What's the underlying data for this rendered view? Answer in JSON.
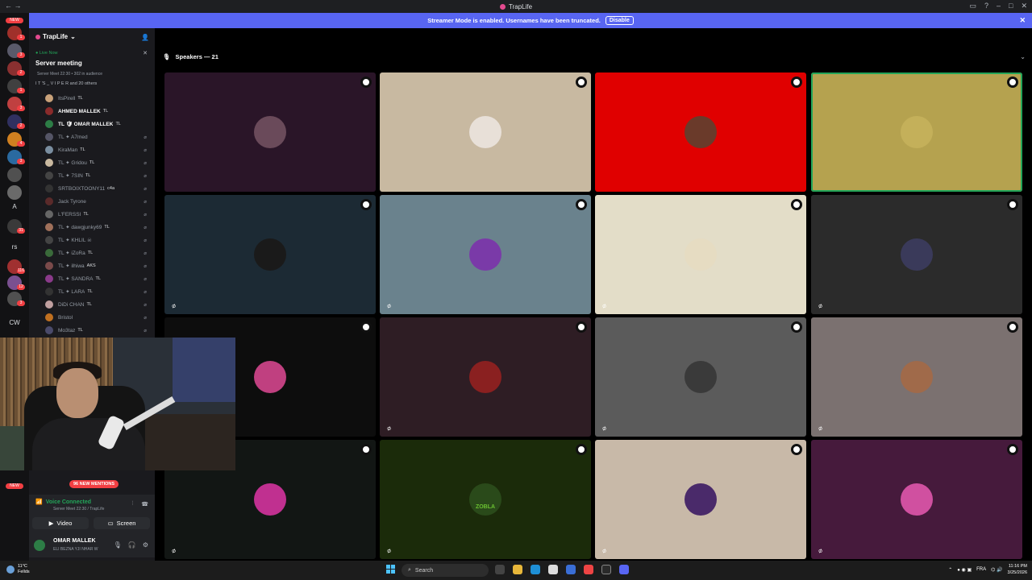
{
  "window": {
    "title": "TrapLife"
  },
  "banner": {
    "text": "Streamer Mode is enabled. Usernames have been truncated.",
    "button": "Disable"
  },
  "rail": {
    "new_label": "NEW",
    "new_label_bottom": "NEW",
    "letters": [
      "A",
      "rs",
      "CW"
    ],
    "badges": [
      "1",
      "3",
      "2",
      "1",
      "3",
      "2",
      "4",
      "3",
      "31",
      "116",
      "12",
      "3",
      "12"
    ]
  },
  "sidebar": {
    "server_name": "TrapLife",
    "live_label": "Live Now",
    "stage_title": "Server meeting",
    "stage_meta": "Server Meet 22:30  •  302 in audience",
    "audience_line": "I T 'S _ V I P E R and 20 others",
    "users": [
      {
        "name": "ItsPirell",
        "tag": "TL",
        "bright": false,
        "color": "#c9a27a",
        "mic": ""
      },
      {
        "name": "AHMED MALLEK",
        "tag": "TL",
        "bright": true,
        "color": "#8a2b2b",
        "mic": ""
      },
      {
        "name": "TL 🛡 OMAR MALLEK",
        "tag": "TL",
        "bright": true,
        "color": "#2d7d46",
        "mic": ""
      },
      {
        "name": "TL ✦ A7med",
        "tag": "",
        "bright": false,
        "color": "#556",
        "mic": "⌀"
      },
      {
        "name": "KiraMan",
        "tag": "TL",
        "bright": false,
        "color": "#7a8ea0",
        "mic": "⌀"
      },
      {
        "name": "TL ✦ Gridou",
        "tag": "TL",
        "bright": false,
        "color": "#c9b9a0",
        "mic": "⌀"
      },
      {
        "name": "TL ✦ 7SIN",
        "tag": "TL",
        "bright": false,
        "color": "#444",
        "mic": "⌀"
      },
      {
        "name": "SRTBOIXTOONY11",
        "tag": "c4a",
        "bright": false,
        "color": "#333",
        "mic": "⌀"
      },
      {
        "name": "Jack Tyrone",
        "tag": "",
        "bright": false,
        "color": "#5a2a2a",
        "mic": "⌀"
      },
      {
        "name": "L'FERSSI",
        "tag": "TL",
        "bright": false,
        "color": "#666",
        "mic": "⌀"
      },
      {
        "name": "TL ✦ dawgjunky69",
        "tag": "TL",
        "bright": false,
        "color": "#a0705a",
        "mic": "⌀"
      },
      {
        "name": "TL ✦ KHLIL ☠",
        "tag": "",
        "bright": false,
        "color": "#444",
        "mic": "⌀"
      },
      {
        "name": "TL ✦ iZoRa",
        "tag": "TL",
        "bright": false,
        "color": "#3a6a3a",
        "mic": "⌀"
      },
      {
        "name": "TL ✦ ilhiwa",
        "tag": "AKS",
        "bright": false,
        "color": "#7a4a4a",
        "mic": "⌀"
      },
      {
        "name": "TL ✦ SANDRA",
        "tag": "TL",
        "bright": false,
        "color": "#8a3a8a",
        "mic": "⌀"
      },
      {
        "name": "TL ✦ LARA",
        "tag": "TL",
        "bright": false,
        "color": "#333",
        "mic": "⌀"
      },
      {
        "name": "DiDi CHAN",
        "tag": "TL",
        "bright": false,
        "color": "#c0a0a0",
        "mic": "⌀"
      },
      {
        "name": "Bristol",
        "tag": "",
        "bright": false,
        "color": "#c07020",
        "mic": "⌀"
      },
      {
        "name": "Mo3taz",
        "tag": "TL",
        "bright": false,
        "color": "#4a4a6a",
        "mic": "⌀"
      }
    ],
    "mentions": "96 NEW MENTIONS"
  },
  "voice": {
    "status": "Voice Connected",
    "sub": "Server Meet 22:30 / TrapLife",
    "video_label": "Video",
    "screen_label": "Screen"
  },
  "user_panel": {
    "name": "OMAR MALLEK",
    "status": "ELI BEZNA YJI NHAR W"
  },
  "stage": {
    "speakers_label": "Speakers — 21",
    "tiles": [
      {
        "bg": "#2a1528",
        "avatar": "#6a4a5a",
        "muted": false,
        "speaking": false
      },
      {
        "bg": "#c8b9a1",
        "avatar": "#e8e0d8",
        "muted": false,
        "speaking": false
      },
      {
        "bg": "#e00000",
        "avatar": "#6a3a2a",
        "muted": false,
        "speaking": false
      },
      {
        "bg": "#b5a24f",
        "avatar": "#c4b05a",
        "muted": false,
        "speaking": true
      },
      {
        "bg": "#1c2a34",
        "avatar": "#1a1a1a",
        "muted": true,
        "speaking": false
      },
      {
        "bg": "#6a828d",
        "avatar": "#7a3aa8",
        "muted": true,
        "speaking": false
      },
      {
        "bg": "#e3ddc8",
        "avatar": "#e6dcc2",
        "muted": true,
        "speaking": false
      },
      {
        "bg": "#2b2b2b",
        "avatar": "#3a3a5a",
        "muted": true,
        "speaking": false
      },
      {
        "bg": "#0d0d0d",
        "avatar": "#c04080",
        "muted": false,
        "speaking": false
      },
      {
        "bg": "#2e1d24",
        "avatar": "#8a2020",
        "muted": true,
        "speaking": false
      },
      {
        "bg": "#5b5b5b",
        "avatar": "#3a3a3a",
        "muted": true,
        "speaking": false
      },
      {
        "bg": "#7b7170",
        "avatar": "#a06a4a",
        "muted": true,
        "speaking": false
      },
      {
        "bg": "#121614",
        "avatar": "#c03090",
        "muted": true,
        "speaking": false
      },
      {
        "bg": "#1b2b0a",
        "avatar": "#2a4a1a",
        "muted": true,
        "speaking": false
      },
      {
        "bg": "#c8b9a8",
        "avatar": "#4a2a6a",
        "muted": true,
        "speaking": false
      },
      {
        "bg": "#461a3c",
        "avatar": "#d050a0",
        "muted": true,
        "speaking": false
      }
    ],
    "tile_tag": "ZOBLA"
  },
  "taskbar": {
    "weather_temp": "11°C",
    "weather_desc": "Fellds",
    "search": "Search",
    "lang": "FRA",
    "time": "11:16 PM",
    "date": "3/25/2026"
  }
}
